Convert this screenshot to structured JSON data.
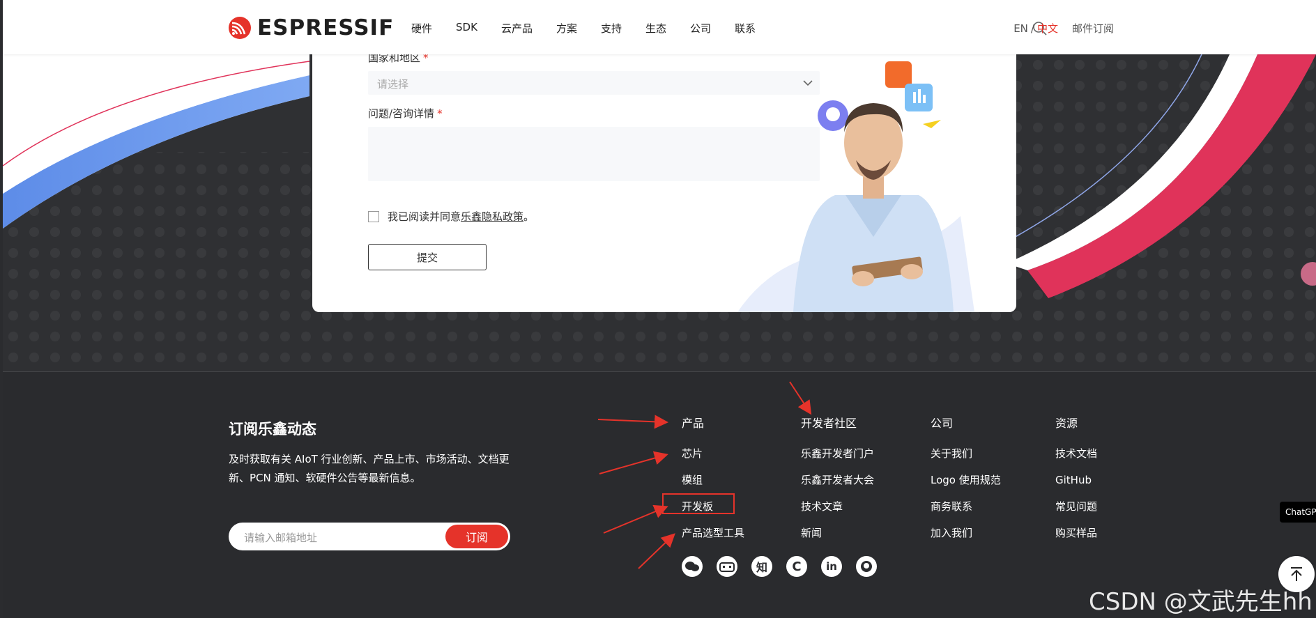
{
  "header": {
    "logo_text": "ESPRESSIF",
    "nav": [
      "硬件",
      "SDK",
      "云产品",
      "方案",
      "支持",
      "生态",
      "公司",
      "联系"
    ],
    "lang_en": "EN",
    "lang_sep": "/",
    "lang_zh": "中文",
    "mail_subscribe": "邮件订阅"
  },
  "form": {
    "country_label": "国家和地区",
    "required_mark": "*",
    "country_placeholder": "请选择",
    "question_label": "问题/咨询详情",
    "agree_prefix": "我已阅读并同意",
    "agree_link": "乐鑫隐私政策",
    "agree_suffix": "。",
    "submit_label": "提交"
  },
  "footer": {
    "subscribe_title": "订阅乐鑫动态",
    "subscribe_desc": "及时获取有关 AIoT 行业创新、产品上市、市场活动、文档更新、PCN 通知、软硬件公告等最新信息。",
    "email_placeholder": "请输入邮箱地址",
    "subscribe_button": "订阅",
    "columns": [
      {
        "head": "产品",
        "items": [
          "芯片",
          "模组",
          "开发板",
          "产品选型工具"
        ]
      },
      {
        "head": "开发者社区",
        "items": [
          "乐鑫开发者门户",
          "乐鑫开发者大会",
          "技术文章",
          "新闻"
        ]
      },
      {
        "head": "公司",
        "items": [
          "关于我们",
          "Logo 使用规范",
          "商务联系",
          "加入我们"
        ]
      },
      {
        "head": "资源",
        "items": [
          "技术文档",
          "GitHub",
          "常见问题",
          "购买样品"
        ]
      }
    ],
    "social_icons": [
      "wechat-icon",
      "bilibili-icon",
      "zhihu-icon",
      "csdn-icon",
      "linkedin-icon",
      "github-icon"
    ],
    "zhihu_glyph": "知",
    "csdn_glyph": "C",
    "linkedin_glyph": "in"
  },
  "overlay": {
    "chatgpt_badge": "ChatGPT",
    "watermark": "CSDN @文武先生hh"
  },
  "colors": {
    "brand_red": "#e5332a",
    "hero_bg": "#2f3033",
    "footer_bg": "#2a2b2e",
    "wave_blue": "#6f9df0",
    "wave_red": "#e0335a"
  }
}
